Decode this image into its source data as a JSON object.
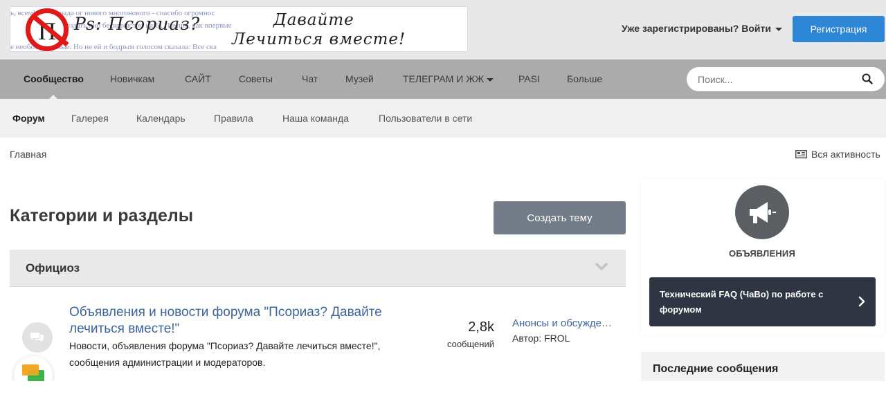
{
  "header": {
    "logo_lines": [
      "ь, всем! Очень рада   ог нового   многонового - спасибо огромнос",
      "Пс создать   нно бескорыстно   на 6   . Помню, как впервые",
      "е необоснованные. Но не   ей   и бодрым голосом сказала: Все ска"
    ],
    "logo_sign_letter": "П",
    "logo_title_a": "Ps: Псориаз?",
    "logo_title_b": "Давайте",
    "logo_title_c": "Лечиться вместе!",
    "login_label": "Уже зарегистрированы? Войти",
    "register_label": "Регистрация"
  },
  "nav_primary": {
    "items": [
      {
        "label": "Сообщество"
      },
      {
        "label": "Новичкам"
      },
      {
        "label": "САЙТ"
      },
      {
        "label": "Советы"
      },
      {
        "label": "Чат"
      },
      {
        "label": "Музей"
      },
      {
        "label": "ТЕЛЕГРАМ И ЖЖ"
      },
      {
        "label": "PASI"
      },
      {
        "label": "Больше"
      }
    ],
    "search_placeholder": "Поиск..."
  },
  "nav_secondary": {
    "items": [
      {
        "label": "Форум"
      },
      {
        "label": "Галерея"
      },
      {
        "label": "Календарь"
      },
      {
        "label": "Правила"
      },
      {
        "label": "Наша команда"
      },
      {
        "label": "Пользователи в сети"
      }
    ]
  },
  "breadcrumb": {
    "home": "Главная"
  },
  "all_activity": "Вся активность",
  "main": {
    "title": "Категории и разделы",
    "create_topic": "Создать тему",
    "category": {
      "title": "Официоз",
      "forum": {
        "title": "Объявления и новости форума \"Псориаз? Давайте лечиться вместе!\"",
        "description": "Новости, объявления форума \"Псориаз? Давайте лечиться вместе!\", сообщения администрации и модераторов.",
        "count": "2,8k",
        "count_label": "сообщений",
        "last_topic": "Анонсы и обсуждение",
        "last_author": "Автор: FROL"
      }
    }
  },
  "sidebar": {
    "announcements_label": "ОБЪЯВЛЕНИЯ",
    "faq_text": "Технический FAQ (ЧаВо) по работе с форумом",
    "recent_title": "Последние сообщения"
  },
  "colors": {
    "register_button": "#2e86d6",
    "nav_primary_bg": "#ababab",
    "nav_secondary_bg": "#f0f0f0",
    "link": "#3a64a0",
    "create_button": "#727d89",
    "faq_bg": "#2f3542"
  },
  "icons": {
    "search": "search-icon",
    "activity": "newspaper-icon",
    "chevron": "chevron-down-icon",
    "forum": "chat-bubbles-icon",
    "announcements": "megaphone-icon",
    "faq_arrow": "chevron-right-icon",
    "widget": "chat-widget-icon"
  }
}
